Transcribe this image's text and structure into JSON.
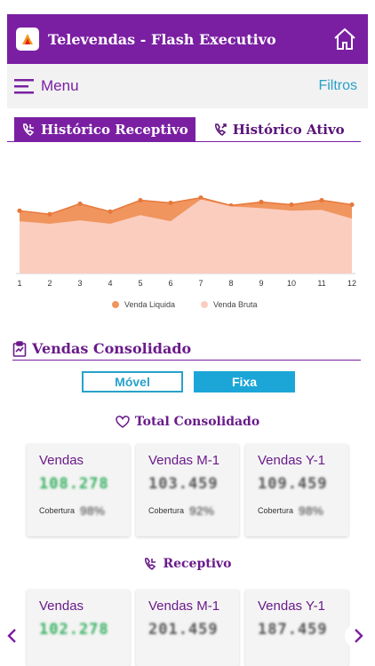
{
  "header": {
    "title": "Televendas - Flash Executivo"
  },
  "menubar": {
    "menu_label": "Menu",
    "filters_label": "Filtros"
  },
  "tabs": [
    {
      "label": "Histórico Receptivo",
      "active": true
    },
    {
      "label": "Histórico Ativo",
      "active": false
    }
  ],
  "chart_data": {
    "type": "area",
    "categories": [
      "1",
      "2",
      "3",
      "4",
      "5",
      "6",
      "7",
      "8",
      "9",
      "10",
      "11",
      "12"
    ],
    "series": [
      {
        "name": "Venda Liquida",
        "color": "#f0955e",
        "values": [
          72,
          68,
          80,
          71,
          84,
          81,
          87,
          78,
          82,
          79,
          84,
          79
        ]
      },
      {
        "name": "Venda Bruta",
        "color": "#fbcdbf",
        "values": [
          60,
          57,
          61,
          57,
          67,
          60,
          85,
          77,
          75,
          72,
          73,
          63
        ]
      }
    ],
    "ylim": [
      0,
      110
    ],
    "legend": "bottom"
  },
  "consolidated": {
    "title": "Vendas Consolidado",
    "toggle": {
      "mobile": "Móvel",
      "fixed": "Fixa",
      "selected": "Fixa"
    }
  },
  "total_section": {
    "title": "Total Consolidado",
    "cards": [
      {
        "label": "Vendas",
        "value": "108.278",
        "cov_label": "Cobertura",
        "cov_value": "98%"
      },
      {
        "label": "Vendas M-1",
        "value": "103.459",
        "cov_label": "Cobertura",
        "cov_value": "92%"
      },
      {
        "label": "Vendas Y-1",
        "value": "109.459",
        "cov_label": "Cobertura",
        "cov_value": "98%"
      }
    ]
  },
  "receptivo_section": {
    "title": "Receptivo",
    "cards": [
      {
        "label": "Vendas",
        "value": "102.278"
      },
      {
        "label": "Vendas M-1",
        "value": "201.459"
      },
      {
        "label": "Vendas Y-1",
        "value": "187.459"
      }
    ]
  },
  "colors": {
    "brand": "#7a1fa2",
    "accent": "#27a2c9",
    "positive": "#35b060"
  }
}
